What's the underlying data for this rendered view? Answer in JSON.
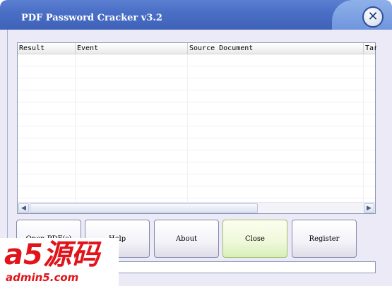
{
  "window": {
    "title": "PDF Password Cracker v3.2",
    "close_glyph": "✕"
  },
  "grid": {
    "columns": [
      "Result",
      "Event",
      "Source Document",
      "Tar"
    ],
    "rows": []
  },
  "scrollbar": {
    "left_arrow": "◀",
    "right_arrow": "▶"
  },
  "buttons": {
    "open": "Open PDF(s)",
    "help": "Help",
    "about": "About",
    "close": "Close",
    "register": "Register"
  },
  "status": {
    "text": ""
  },
  "watermark": {
    "logo": "a5源码",
    "url": "admin5.com"
  },
  "colors": {
    "titlebar": "#4a6fc6",
    "window_bg": "#eceaf6",
    "highlight_button": "#eef8d9",
    "watermark_red": "#e0141a"
  }
}
